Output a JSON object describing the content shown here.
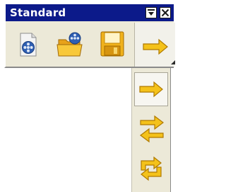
{
  "toolbar": {
    "title": "Standard",
    "menu_button_icon": "dropdown-menu-icon",
    "close_button_icon": "close-icon",
    "tools": [
      {
        "id": "movie-document",
        "icon": "movie-document-icon"
      },
      {
        "id": "open-folder",
        "icon": "open-folder-icon"
      },
      {
        "id": "save",
        "icon": "floppy-disk-icon"
      }
    ],
    "dropdown_tool": {
      "icon": "arrow-right-icon"
    }
  },
  "flyout": {
    "items": [
      {
        "id": "play-forward",
        "icon": "arrow-right-icon",
        "selected": true
      },
      {
        "id": "play-ping-pong",
        "icon": "arrows-back-forth-icon",
        "selected": false
      },
      {
        "id": "play-loop",
        "icon": "loop-arrows-icon",
        "selected": false
      }
    ]
  },
  "colors": {
    "title_bar": "#0c1a8a",
    "title_text": "#ffffff",
    "toolbar_face": "#ece9d8",
    "arrow_fill": "#f4c21a",
    "arrow_stroke": "#b07a00"
  }
}
